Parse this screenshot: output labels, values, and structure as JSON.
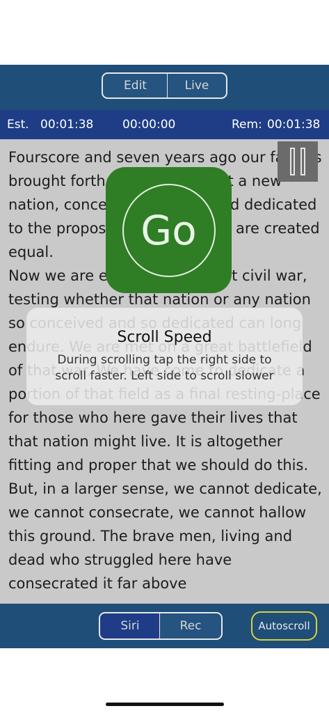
{
  "top_toggle": {
    "edit_label": "Edit",
    "live_label": "Live",
    "selected": "Live"
  },
  "times": {
    "est_label": "Est.",
    "est_value": "00:01:38",
    "elapsed": "00:00:00",
    "rem_label": "Rem:",
    "rem_value": "00:01:38"
  },
  "script": {
    "paragraphs": [
      "Fourscore and seven years ago our fathers brought forth on this continent a new nation, conceived in liberty and dedicated to the proposition that all men are created equal.",
      "Now we are engaged in a great civil war, testing whether that nation or any nation so conceived and so dedicated can long endure. We are met on a great battlefield of that war. We have come to dedicate a portion of that field as a final resting-place for those who here gave their lives that that nation might live. It is altogether fitting and proper that we should do this.",
      "But, in a larger sense, we cannot dedicate, we cannot consecrate, we cannot hallow this ground. The brave men, living and dead who struggled here have consecrated it far above"
    ]
  },
  "go_button": {
    "label": "Go",
    "color": "#2f7d25"
  },
  "toast": {
    "title": "Scroll Speed",
    "message": "During scrolling tap the right side to scroll faster. Left side to scroll slower"
  },
  "bottom_toggle": {
    "siri_label": "Siri",
    "rec_label": "Rec",
    "selected": "Siri"
  },
  "autoscroll_label": "Autoscroll",
  "colors": {
    "bar": "#1f4e79",
    "time_bar": "#1e3d86",
    "accent": "#d6d23e"
  },
  "icons": {
    "pause": "pause-icon"
  }
}
